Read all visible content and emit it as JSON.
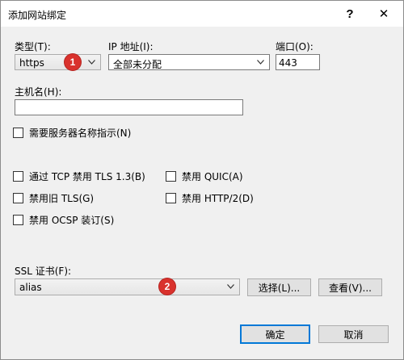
{
  "title": "添加网站绑定",
  "titlebar": {
    "help_label": "?",
    "close_label": "✕"
  },
  "type": {
    "label": "类型(T):",
    "value": "https"
  },
  "ip": {
    "label": "IP 地址(I):",
    "value": "全部未分配"
  },
  "port": {
    "label": "端口(O):",
    "value": "443"
  },
  "hostname": {
    "label": "主机名(H):",
    "value": ""
  },
  "sni": {
    "label": "需要服务器名称指示(N)",
    "checked": false
  },
  "options": [
    {
      "label": "通过 TCP 禁用 TLS 1.3(B)",
      "checked": false
    },
    {
      "label": "禁用 QUIC(A)",
      "checked": false
    },
    {
      "label": "禁用旧 TLS(G)",
      "checked": false
    },
    {
      "label": "禁用 HTTP/2(D)",
      "checked": false
    },
    {
      "label": "禁用 OCSP 装订(S)",
      "checked": false
    }
  ],
  "ssl": {
    "label": "SSL 证书(F):",
    "value": "alias",
    "select_button": "选择(L)...",
    "view_button": "查看(V)..."
  },
  "buttons": {
    "ok": "确定",
    "cancel": "取消"
  },
  "badges": [
    "1",
    "2"
  ],
  "colors": {
    "badge": "#d9322d",
    "default_button_border": "#0078d7"
  }
}
